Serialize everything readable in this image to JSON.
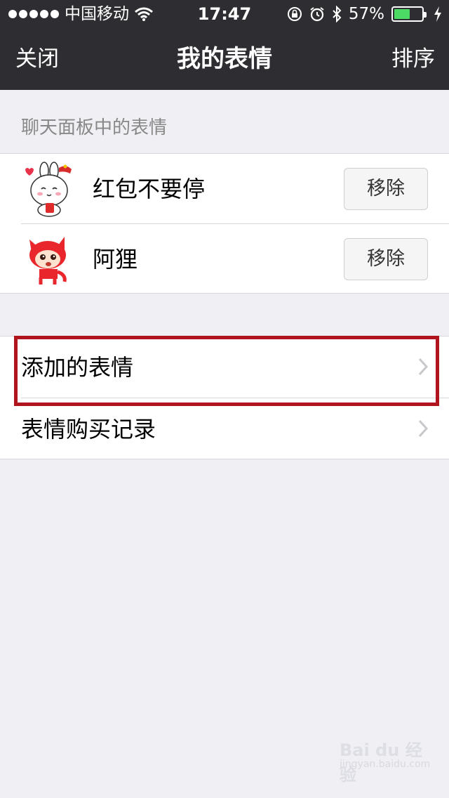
{
  "status_bar": {
    "carrier": "中国移动",
    "time": "17:47",
    "battery_percent": "57%",
    "battery_level": 0.57,
    "battery_color": "#4cd964",
    "icons": [
      "signal-dots-icon",
      "wifi-icon",
      "rotation-lock-icon",
      "alarm-icon",
      "bluetooth-icon",
      "battery-icon",
      "charging-bolt-icon"
    ]
  },
  "navbar": {
    "left_label": "关闭",
    "title": "我的表情",
    "right_label": "排序"
  },
  "sticker_section": {
    "header": "聊天面板中的表情",
    "items": [
      {
        "name": "红包不要停",
        "button_label": "移除",
        "icon": "bunny-sticker-icon"
      },
      {
        "name": "阿狸",
        "button_label": "移除",
        "icon": "fox-sticker-icon"
      }
    ]
  },
  "menu": {
    "items": [
      {
        "label": "添加的表情",
        "icon": "chevron-right-icon",
        "highlighted": true
      },
      {
        "label": "表情购买记录",
        "icon": "chevron-right-icon"
      }
    ],
    "highlight_color": "#b0141c"
  },
  "watermark": {
    "brand": "Bai du 经验",
    "url": "jingyan.baidu.com"
  }
}
